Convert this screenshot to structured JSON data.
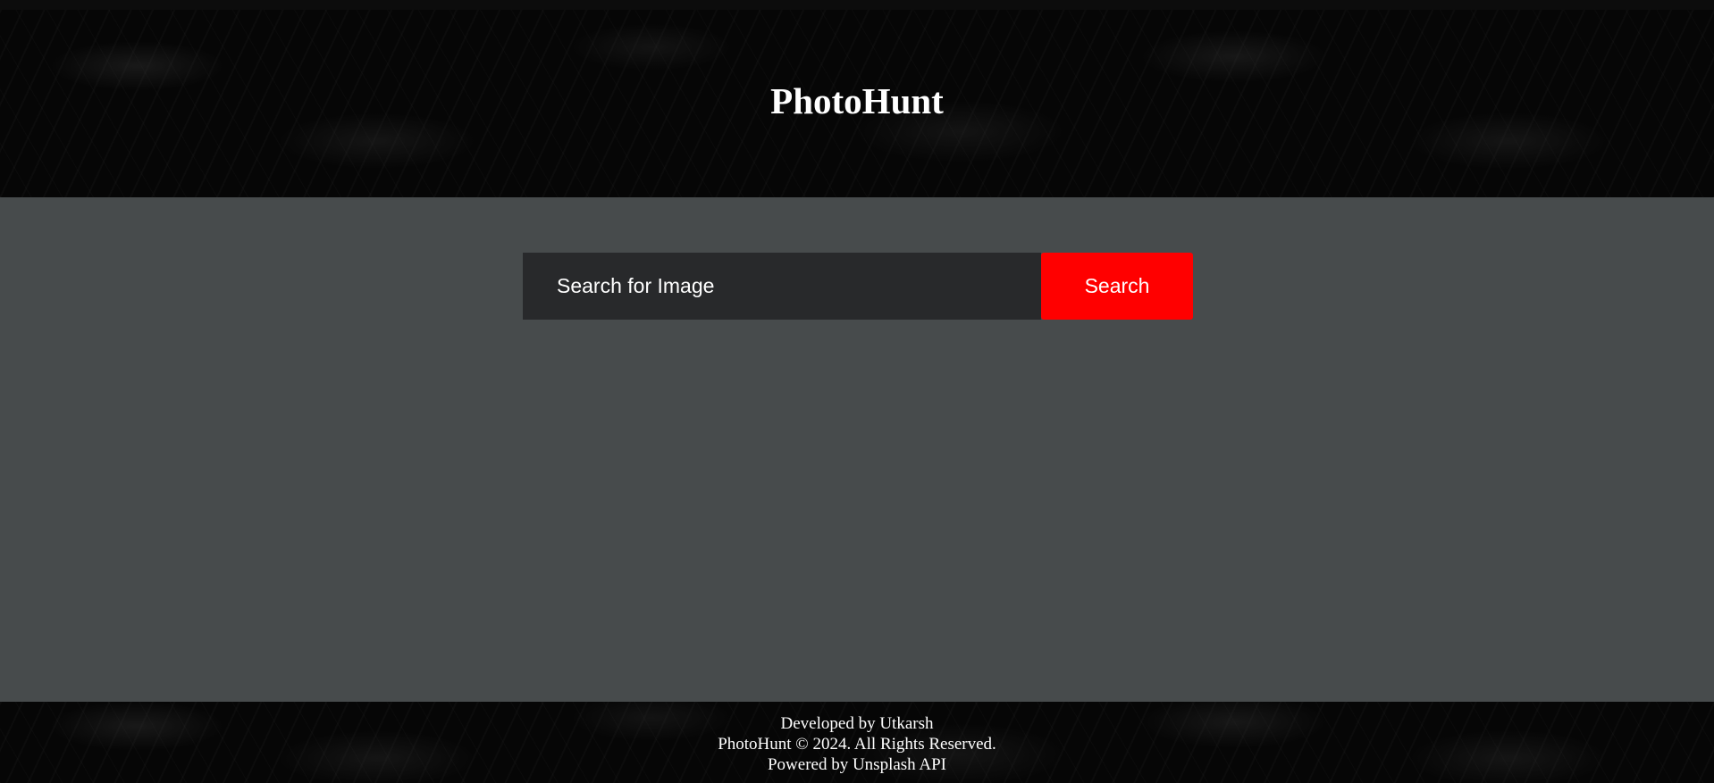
{
  "header": {
    "title": "PhotoHunt"
  },
  "search": {
    "placeholder": "Search for Image",
    "value": "",
    "button_label": "Search"
  },
  "footer": {
    "developer_line": "Developed by Utkarsh",
    "copyright_line": "PhotoHunt © 2024. All Rights Reserved.",
    "powered_line": "Powered by Unsplash API"
  },
  "colors": {
    "header_bg": "#060606",
    "main_bg": "#474b4c",
    "input_bg": "#28292b",
    "button_bg": "#ff0000",
    "text": "#ffffff"
  }
}
